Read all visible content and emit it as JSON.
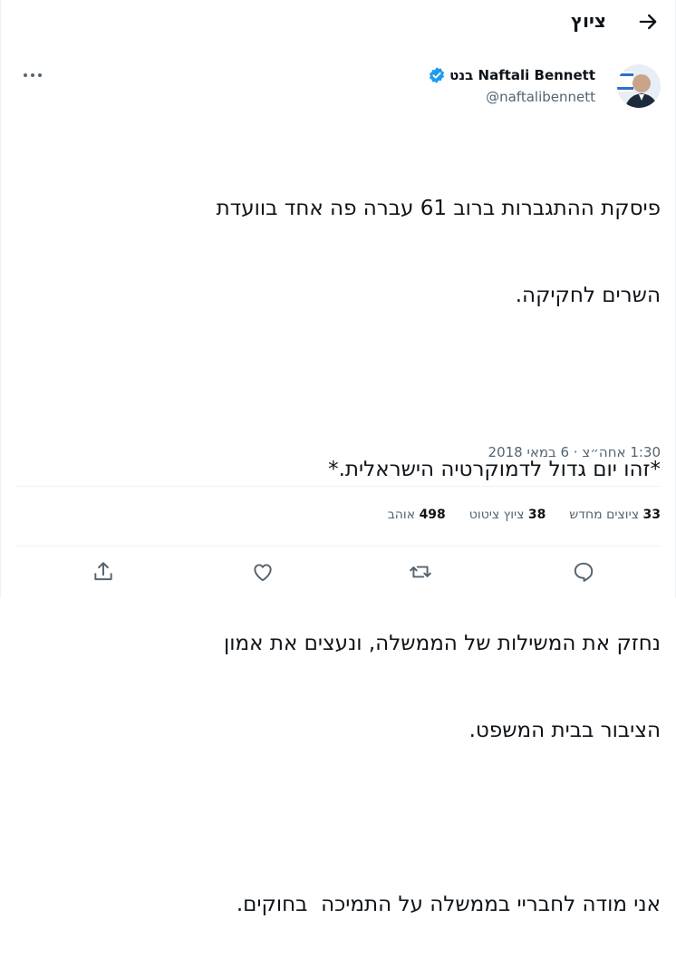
{
  "header": {
    "title": "ציוץ"
  },
  "author": {
    "name": "Naftali Bennett בנט",
    "handle": "@naftalibennett"
  },
  "tweet": {
    "lines": [
      "פיסקת ההתגברות ברוב 61 עברה פה אחד בוועדת",
      "השרים לחקיקה.",
      "",
      "*זהו יום גדול לדמוקרטיה הישראלית.*",
      "",
      "נחזק את המשילות של הממשלה, ונעצים את אמון",
      "הציבור בבית המשפט.",
      "",
      "אני מודה לחבריי בממשלה על התמיכה  בחוקים."
    ],
    "timestamp": "1:30 אחה״צ · 6 במאי 2018"
  },
  "stats": [
    {
      "count": "33",
      "label": "ציוצים מחדש"
    },
    {
      "count": "38",
      "label": "ציוץ ציטוט"
    },
    {
      "count": "498",
      "label": "אוהב"
    }
  ],
  "colors": {
    "accent": "#1d9bf0",
    "secondary_text": "#536471",
    "divider": "#eff3f4"
  },
  "icons": [
    "back-arrow-icon",
    "verified-badge-icon",
    "more-options-icon",
    "reply-icon",
    "retweet-icon",
    "like-icon",
    "share-icon"
  ]
}
